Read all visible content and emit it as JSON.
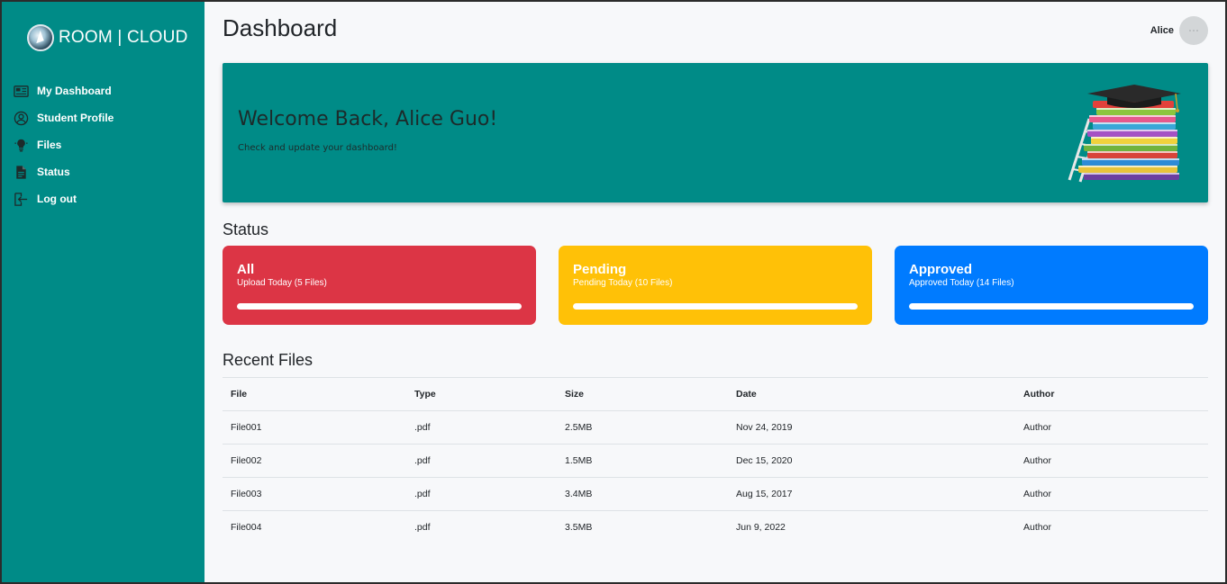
{
  "brand": {
    "name": "ROOM | CLOUD"
  },
  "sidebar": {
    "items": [
      {
        "label": "My Dashboard",
        "icon": "dashboard-icon"
      },
      {
        "label": "Student Profile",
        "icon": "user-circle-icon"
      },
      {
        "label": "Files",
        "icon": "lightbulb-icon"
      },
      {
        "label": "Status",
        "icon": "document-icon"
      },
      {
        "label": "Log out",
        "icon": "logout-icon"
      }
    ]
  },
  "header": {
    "title": "Dashboard",
    "user_name": "Alice"
  },
  "hero": {
    "title": "Welcome Back, Alice Guo!",
    "subtitle": "Check and update your dashboard!",
    "illustration": "books-graduation-cap-illustration"
  },
  "status": {
    "title": "Status",
    "cards": [
      {
        "title": "All",
        "subtitle": "Upload Today (5 Files)",
        "color": "#dc3545",
        "progress": 1.0
      },
      {
        "title": "Pending",
        "subtitle": "Pending Today (10 Files)",
        "color": "#ffc107",
        "progress": 1.0
      },
      {
        "title": "Approved",
        "subtitle": "Approved Today (14 Files)",
        "color": "#007bff",
        "progress": 1.0
      }
    ]
  },
  "recent_files": {
    "title": "Recent Files",
    "columns": [
      "File",
      "Type",
      "Size",
      "Date",
      "Author"
    ],
    "rows": [
      [
        "File001",
        ".pdf",
        "2.5MB",
        "Nov 24, 2019",
        "Author"
      ],
      [
        "File002",
        ".pdf",
        "1.5MB",
        "Dec 15, 2020",
        "Author"
      ],
      [
        "File003",
        ".pdf",
        "3.4MB",
        "Aug 15, 2017",
        "Author"
      ],
      [
        "File004",
        ".pdf",
        "3.5MB",
        "Jun 9, 2022",
        "Author"
      ]
    ]
  },
  "colors": {
    "sidebar": "#008b87",
    "hero": "#008b87",
    "background": "#f7f8fa"
  }
}
